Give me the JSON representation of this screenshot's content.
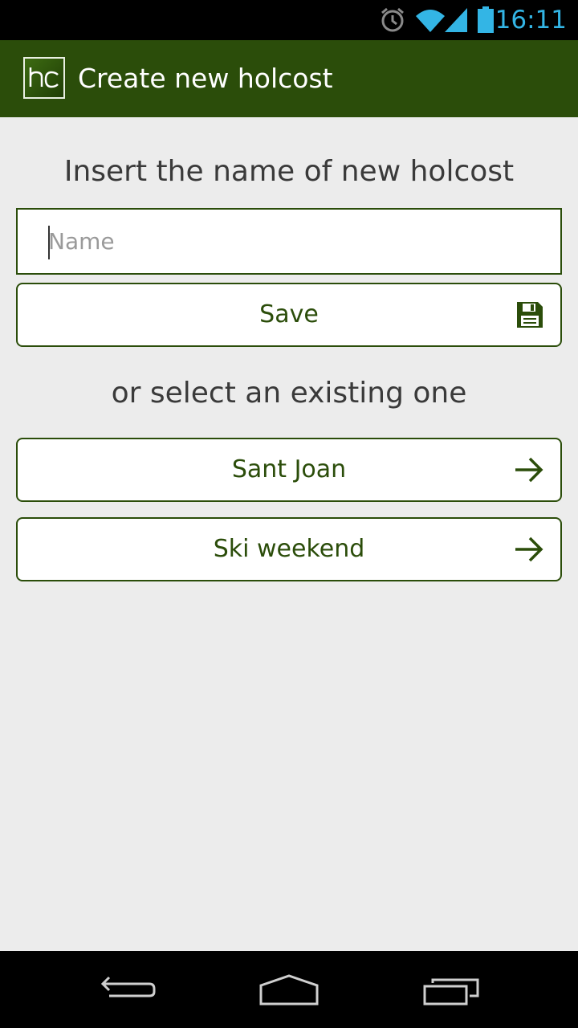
{
  "status_bar": {
    "time": "16:11",
    "icons": [
      "alarm-icon",
      "wifi-icon",
      "signal-icon",
      "battery-icon"
    ],
    "time_color": "#33b5e5"
  },
  "action_bar": {
    "logo_text": "hc",
    "title": "Create new holcost",
    "background": "#2b4d0a"
  },
  "create": {
    "heading": "Insert the name of new holcost",
    "name_placeholder": "Name",
    "name_value": "",
    "save_label": "Save",
    "save_icon": "floppy-disk-icon"
  },
  "existing": {
    "heading": "or select an existing one",
    "items": [
      {
        "label": "Sant Joan",
        "icon": "arrow-right-icon"
      },
      {
        "label": "Ski weekend",
        "icon": "arrow-right-icon"
      }
    ]
  },
  "nav_bar": {
    "buttons": [
      "back-icon",
      "home-icon",
      "recent-apps-icon"
    ]
  }
}
